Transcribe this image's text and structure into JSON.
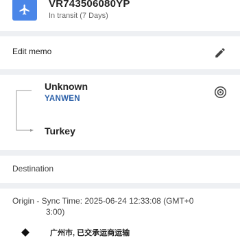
{
  "header": {
    "tracking_number": "VR743506080YP",
    "status": "In transit (7 Days)"
  },
  "memo": {
    "label": "Edit memo"
  },
  "route": {
    "origin": "Unknown",
    "carrier": "YANWEN",
    "destination": "Turkey"
  },
  "destination_section": {
    "label": "Destination"
  },
  "origin_section": {
    "label": "Origin - Sync Time: 2025-06-24 12:33:08 (GMT+0",
    "label_wrap": "3:00)"
  },
  "events": [
    {
      "text": "广州市, 已交承运商运输"
    }
  ],
  "colors": {
    "accent": "#4a86e8",
    "carrier": "#2a5fa8",
    "divider": "#eef0f3"
  }
}
